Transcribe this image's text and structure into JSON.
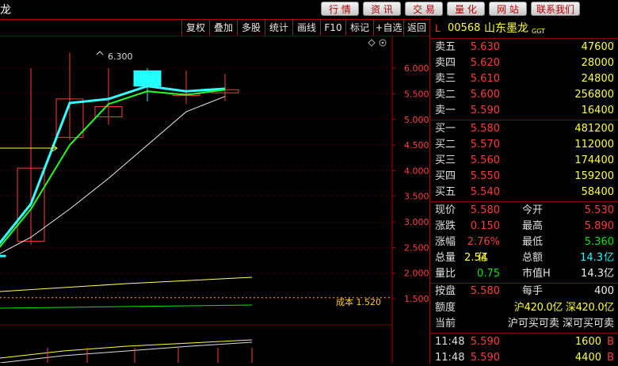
{
  "window": {
    "title_fragment": "龙"
  },
  "nav_buttons": [
    "行 情",
    "资 讯",
    "交 易",
    "量 化",
    "网 站",
    "联系我们"
  ],
  "toolbar": [
    "复权",
    "叠加",
    "多股",
    "统计",
    "画线",
    "F10",
    "标记",
    "+自选",
    "返回"
  ],
  "chart": {
    "high_label": "6.300",
    "cost_label": "成本 1.520",
    "price_ticks": [
      "6.000",
      "5.500",
      "5.000",
      "4.500",
      "4.000",
      "3.500",
      "3.000",
      "2.500",
      "2.000",
      "1.500"
    ],
    "price_range": [
      1.3,
      6.45
    ]
  },
  "chart_data": {
    "type": "candlestick",
    "yticks": [
      6.0,
      5.5,
      5.0,
      4.5,
      4.0,
      3.5,
      3.0,
      2.5,
      2.0,
      1.5
    ],
    "ylim": [
      1.3,
      6.45
    ],
    "annotations": [
      "6.300",
      "成本 1.520"
    ],
    "candles": [
      {
        "open": 2.32,
        "close": 2.35,
        "high": 2.38,
        "low": 2.28
      },
      {
        "open": 2.62,
        "close": 4.05,
        "high": 6.0,
        "low": 2.55
      },
      {
        "open": 4.65,
        "close": 5.4,
        "high": 6.3,
        "low": 4.6
      },
      {
        "open": 5.05,
        "close": 5.25,
        "high": 6.0,
        "low": 4.9
      },
      {
        "open": 5.65,
        "close": 5.95,
        "high": 6.0,
        "low": 5.35
      },
      {
        "open": 5.5,
        "close": 5.5,
        "high": 5.95,
        "low": 5.3
      },
      {
        "open": 5.58,
        "close": 5.52,
        "high": 5.89,
        "low": 5.36
      }
    ],
    "series": [
      {
        "values": [
          2.4,
          3.35,
          5.32,
          5.4,
          5.65,
          5.55,
          5.6
        ]
      },
      {
        "values": [
          2.33,
          3.25,
          4.5,
          5.3,
          5.55,
          5.48,
          5.58
        ]
      },
      {
        "values": [
          2.3,
          2.7,
          3.25,
          3.85,
          4.5,
          5.15,
          5.45
        ]
      }
    ]
  },
  "quote": {
    "code": "00568",
    "name": "山东墨龙",
    "tag": "GGT",
    "asks": [
      {
        "label": "卖五",
        "price": "5.630",
        "vol": "47600"
      },
      {
        "label": "卖四",
        "price": "5.620",
        "vol": "28000"
      },
      {
        "label": "卖三",
        "price": "5.610",
        "vol": "24800"
      },
      {
        "label": "卖二",
        "price": "5.600",
        "vol": "256800"
      },
      {
        "label": "卖一",
        "price": "5.590",
        "vol": "16400"
      }
    ],
    "bids": [
      {
        "label": "买一",
        "price": "5.580",
        "vol": "481200"
      },
      {
        "label": "买二",
        "price": "5.570",
        "vol": "112000"
      },
      {
        "label": "买三",
        "price": "5.560",
        "vol": "174400"
      },
      {
        "label": "买四",
        "price": "5.550",
        "vol": "159200"
      },
      {
        "label": "买五",
        "price": "5.540",
        "vol": "58400"
      }
    ],
    "stats": {
      "now_l": "现价",
      "now": "5.580",
      "open_l": "今开",
      "open": "5.530",
      "chg_l": "涨跌",
      "chg": "0.150",
      "high_l": "最高",
      "high": "5.890",
      "pct_l": "涨幅",
      "pct": "2.76%",
      "low_l": "最低",
      "low": "5.360",
      "vol_l": "总量",
      "vol": "2.54",
      "vol_u": "亿",
      "amt_l": "总额",
      "amt": "14.3",
      "amt_u": "亿",
      "ratio_l": "量比",
      "ratio": "0.75",
      "cap_l": "市值H",
      "cap": "14.3亿"
    },
    "plate": {
      "pan_l": "按盘",
      "pan": "5.580",
      "lot_l": "每手",
      "lot": "400",
      "quota_l": "额度",
      "quota": "沪420.0亿 深420.0亿",
      "cur_l": "当前",
      "cur": "沪可买可卖 深可买可卖"
    },
    "ticks": [
      {
        "time": "11:48",
        "price": "5.590",
        "vol": "1600",
        "side": "B"
      },
      {
        "time": "11:48",
        "price": "5.590",
        "vol": "4400",
        "side": "B"
      }
    ]
  }
}
